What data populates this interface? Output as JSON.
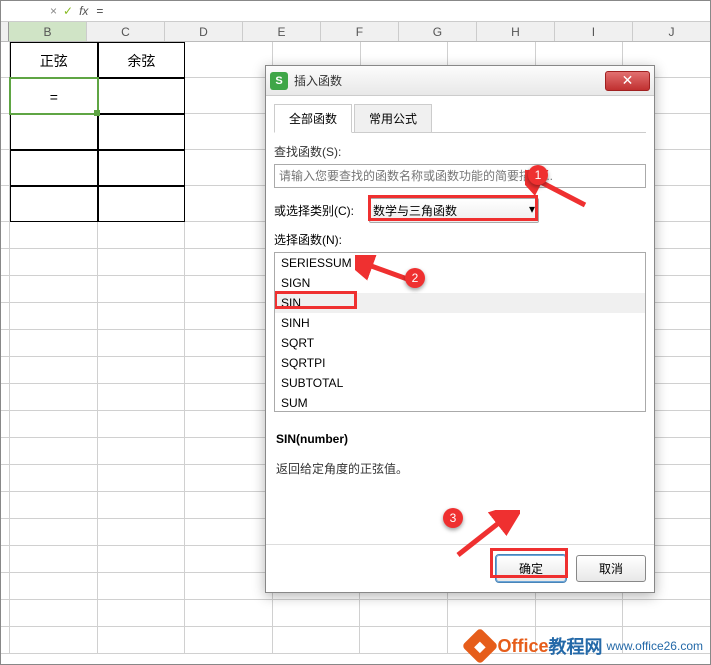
{
  "formula_bar": {
    "x_icon": "×",
    "check_icon": "✓",
    "fx_label": "fx",
    "value": "="
  },
  "columns": [
    "B",
    "C",
    "D",
    "E",
    "F",
    "G",
    "H",
    "I",
    "J"
  ],
  "active_column": "B",
  "table": {
    "header_row": [
      "正弦",
      "余弦"
    ],
    "active_cell_value": "="
  },
  "dialog": {
    "title": "插入函数",
    "app_icon_letter": "S",
    "close_icon": "✕",
    "tabs": [
      {
        "label": "全部函数",
        "active": true
      },
      {
        "label": "常用公式",
        "active": false
      }
    ],
    "search_label": "查找函数(S):",
    "search_placeholder": "请输入您要查找的函数名称或函数功能的简要描述...",
    "category_label": "或选择类别(C):",
    "category_value": "数学与三角函数",
    "func_list_label": "选择函数(N):",
    "functions": [
      "SERIESSUM",
      "SIGN",
      "SIN",
      "SINH",
      "SQRT",
      "SQRTPI",
      "SUBTOTAL",
      "SUM"
    ],
    "selected_function": "SIN",
    "signature": "SIN(number)",
    "description": "返回给定角度的正弦值。",
    "ok_button": "确定",
    "cancel_button": "取消"
  },
  "badges": {
    "b1": "1",
    "b2": "2",
    "b3": "3"
  },
  "watermark": {
    "brand1": "Office",
    "brand2": "教程网",
    "url": "www.office26.com"
  }
}
